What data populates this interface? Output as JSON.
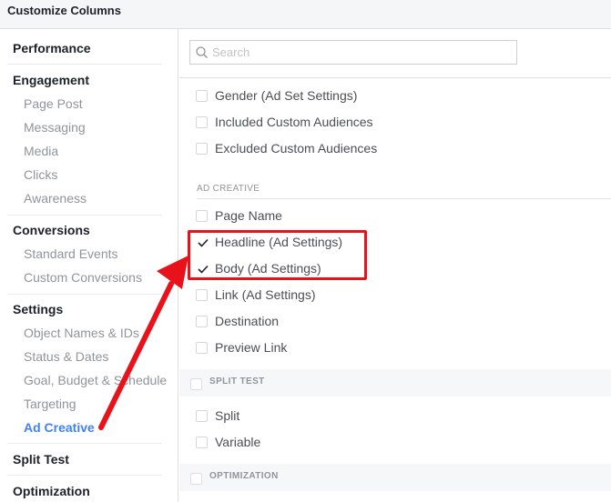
{
  "header": {
    "title": "Customize Columns"
  },
  "sidebar": {
    "groups": [
      {
        "title": "Performance",
        "items": []
      },
      {
        "title": "Engagement",
        "items": [
          "Page Post",
          "Messaging",
          "Media",
          "Clicks",
          "Awareness"
        ]
      },
      {
        "title": "Conversions",
        "items": [
          "Standard Events",
          "Custom Conversions"
        ]
      },
      {
        "title": "Settings",
        "items": [
          "Object Names & IDs",
          "Status & Dates",
          "Goal, Budget & Schedule",
          "Targeting",
          "Ad Creative"
        ]
      },
      {
        "title": "Split Test",
        "items": []
      },
      {
        "title": "Optimization",
        "items": []
      }
    ],
    "active_item": "Ad Creative",
    "active_color": "#4080ff"
  },
  "search": {
    "placeholder": "Search",
    "value": ""
  },
  "columns": {
    "targeting_items": [
      {
        "label": "Gender (Ad Set Settings)",
        "checked": false
      },
      {
        "label": "Included Custom Audiences",
        "checked": false
      },
      {
        "label": "Excluded Custom Audiences",
        "checked": false
      }
    ],
    "ad_creative": {
      "section_label": "AD CREATIVE",
      "items": [
        {
          "label": "Page Name",
          "checked": false
        },
        {
          "label": "Headline (Ad Settings)",
          "checked": true
        },
        {
          "label": "Body (Ad Settings)",
          "checked": true
        },
        {
          "label": "Link (Ad Settings)",
          "checked": false
        },
        {
          "label": "Destination",
          "checked": false
        },
        {
          "label": "Preview Link",
          "checked": false
        }
      ]
    },
    "split_test": {
      "section_label": "SPLIT TEST",
      "checked": false,
      "items": [
        {
          "label": "Split",
          "checked": false
        },
        {
          "label": "Variable",
          "checked": false
        }
      ]
    },
    "optimization": {
      "section_label": "OPTIMIZATION",
      "checked": false
    }
  },
  "annotation": {
    "color": "#e8121b",
    "highlighted_items": [
      "Headline (Ad Settings)",
      "Body (Ad Settings)"
    ]
  }
}
